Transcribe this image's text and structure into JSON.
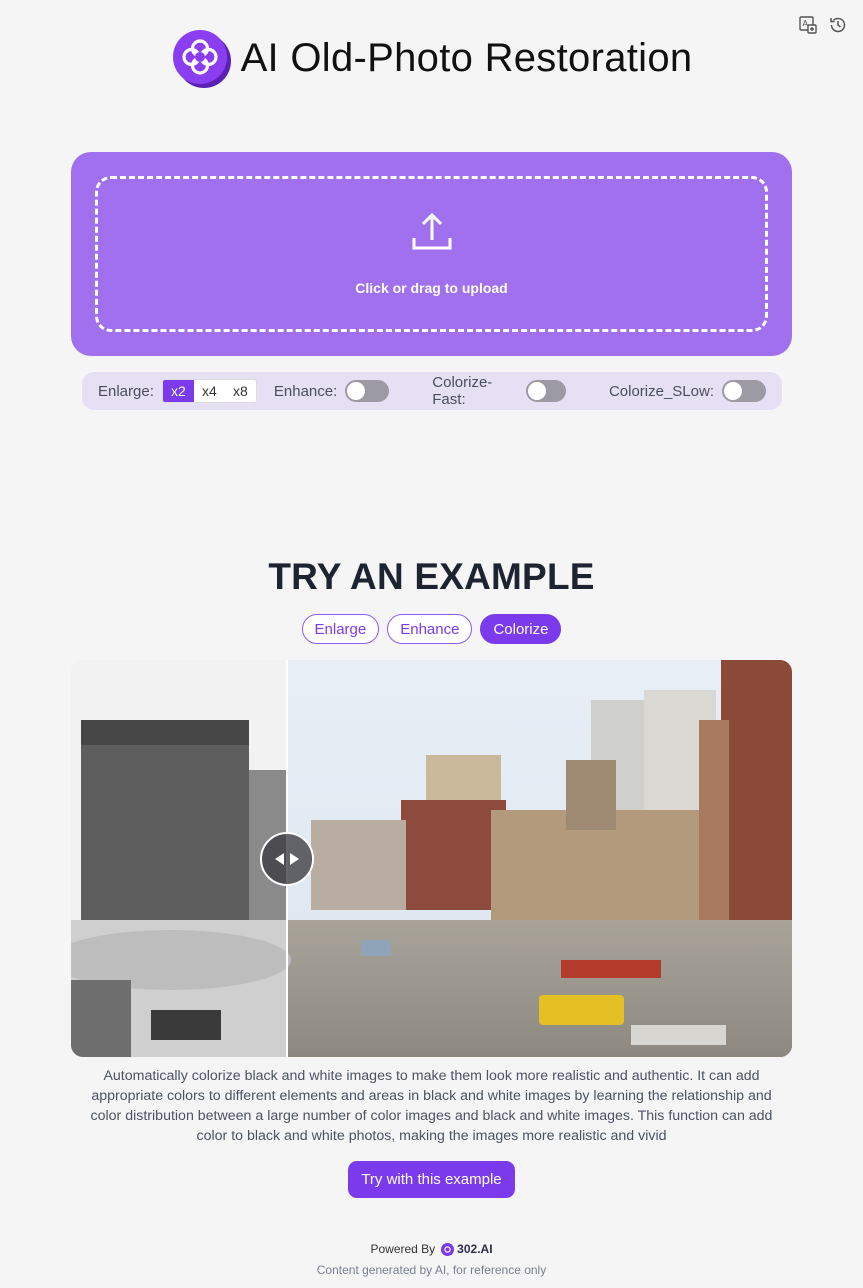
{
  "header": {
    "title": "AI Old-Photo Restoration"
  },
  "top_tools": {
    "icons": [
      "translate-icon",
      "history-icon"
    ]
  },
  "upload": {
    "label": "Click or drag to upload",
    "icon": "upload-icon"
  },
  "options": {
    "enlarge_label": "Enlarge:",
    "scales": [
      "x2",
      "x4",
      "x8"
    ],
    "selected_scale": "x2",
    "enhance_label": "Enhance:",
    "enhance_on": false,
    "colorize_fast_label": "Colorize-Fast:",
    "colorize_fast_on": false,
    "colorize_slow_label": "Colorize_SLow:",
    "colorize_slow_on": false
  },
  "example": {
    "title": "TRY AN EXAMPLE",
    "tabs": [
      "Enlarge",
      "Enhance",
      "Colorize"
    ],
    "active_tab": "Colorize",
    "description": "Automatically colorize black and white images to make them look more realistic and authentic. It can add appropriate colors to different elements and areas in black and white images by learning the relationship and color distribution between a large number of color images and black and white images. This function can add color to black and white photos, making the images more realistic and vivid",
    "try_button": "Try with this example"
  },
  "footer": {
    "powered_by": "Powered By",
    "brand": "302.AI",
    "disclaimer": "Content generated by AI, for reference only"
  },
  "colors": {
    "accent": "#7c3aed",
    "upload_bg": "#a070ee",
    "options_bg": "#e6e0f4"
  }
}
